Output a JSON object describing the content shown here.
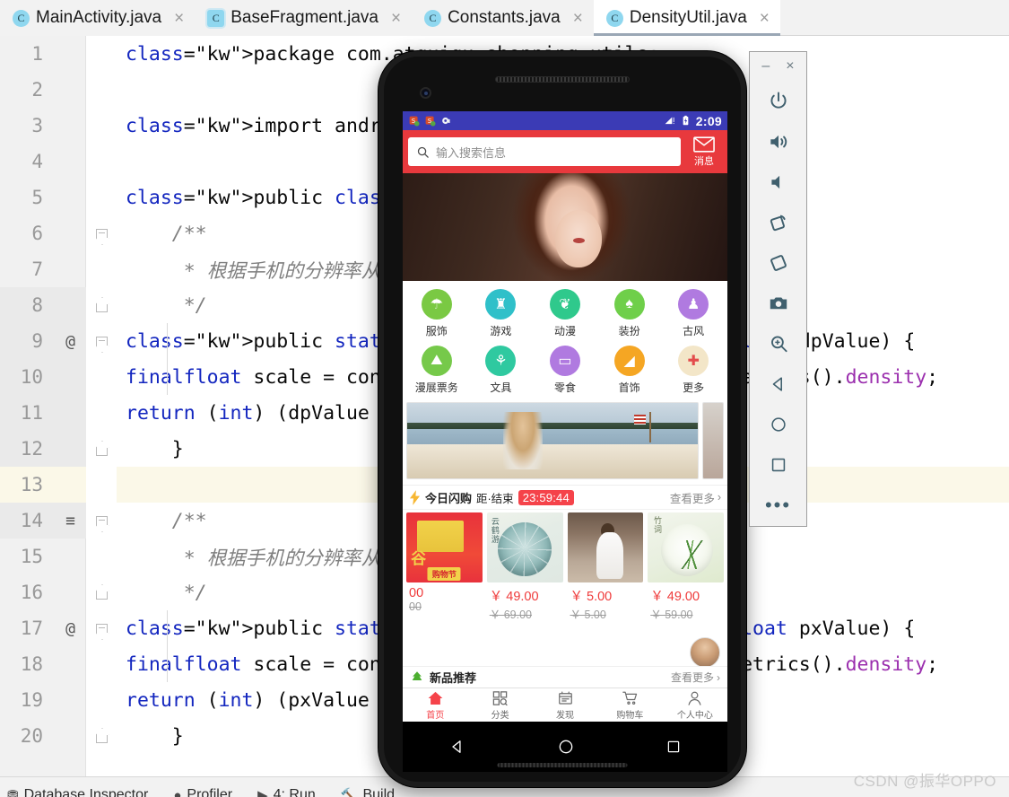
{
  "ide": {
    "tabs": [
      {
        "label": "MainActivity.java",
        "icon": "java-class-icon",
        "active": false,
        "boxed": false
      },
      {
        "label": "BaseFragment.java",
        "icon": "java-class-icon",
        "active": false,
        "boxed": true
      },
      {
        "label": "Constants.java",
        "icon": "java-class-icon",
        "active": false,
        "boxed": false
      },
      {
        "label": "DensityUtil.java",
        "icon": "java-class-icon",
        "active": true,
        "boxed": false
      }
    ],
    "tab_close_glyph": "×",
    "code_lines": [
      {
        "num": "1",
        "text": "package com.atguigu.shopping.utils;",
        "kind": "kw1",
        "fold": "",
        "mark": ""
      },
      {
        "num": "2",
        "text": "",
        "kind": "plain",
        "fold": "",
        "mark": ""
      },
      {
        "num": "3",
        "text": "import android.content.Context;",
        "kind": "kw1",
        "fold": "",
        "mark": ""
      },
      {
        "num": "4",
        "text": "",
        "kind": "plain",
        "fold": "",
        "mark": ""
      },
      {
        "num": "5",
        "text": "public class DensityUtil {",
        "kind": "kw2",
        "fold": "",
        "mark": ""
      },
      {
        "num": "6",
        "text": "    /**",
        "kind": "cm",
        "fold": "down",
        "mark": ""
      },
      {
        "num": "7",
        "text": "     * 根据手机的分辨率从 dp 的单位 转成为 px(像素)",
        "kind": "cm",
        "fold": "",
        "mark": ""
      },
      {
        "num": "8",
        "text": "     */",
        "kind": "cm",
        "fold": "up",
        "mark": ""
      },
      {
        "num": "9",
        "text": "    public static int dip2px(Context context, float dpValue) {",
        "kind": "kw3",
        "fold": "down",
        "mark": "@"
      },
      {
        "num": "10",
        "text": "        final float scale = context.getResources().getDisplayMetrics().density;",
        "kind": "kw4",
        "fold": "",
        "mark": ""
      },
      {
        "num": "11",
        "text": "        return (int) (dpValue * scale + 0.5f);",
        "kind": "kw5",
        "fold": "",
        "mark": ""
      },
      {
        "num": "12",
        "text": "    }",
        "kind": "plain",
        "fold": "up",
        "mark": ""
      },
      {
        "num": "13",
        "text": "",
        "kind": "plain",
        "fold": "",
        "mark": "",
        "highlight": true
      },
      {
        "num": "14",
        "text": "    /**",
        "kind": "cm",
        "fold": "down",
        "mark": "≡"
      },
      {
        "num": "15",
        "text": "     * 根据手机的分辨率从 px(像素) 的单位 转成为 dp",
        "kind": "cm",
        "fold": "",
        "mark": ""
      },
      {
        "num": "16",
        "text": "     */",
        "kind": "cm",
        "fold": "up",
        "mark": ""
      },
      {
        "num": "17",
        "text": "    public static int px2dip(Context context, float pxValue) {",
        "kind": "kw3",
        "fold": "down",
        "mark": "@"
      },
      {
        "num": "18",
        "text": "        final float scale = context.getResources().getDisplayMetrics().density;",
        "kind": "kw4",
        "fold": "",
        "mark": ""
      },
      {
        "num": "19",
        "text": "        return (int) (pxValue / scale + 0.5f);",
        "kind": "kw5",
        "fold": "",
        "mark": ""
      },
      {
        "num": "20",
        "text": "    }",
        "kind": "plain",
        "fold": "up",
        "mark": ""
      }
    ],
    "status_items": [
      "Database Inspector",
      "Profiler",
      "4: Run",
      "Build"
    ]
  },
  "emulator": {
    "window_minimize": "–",
    "window_close": "×",
    "buttons": [
      {
        "name": "power-icon"
      },
      {
        "name": "volume-up-icon"
      },
      {
        "name": "volume-down-icon"
      },
      {
        "name": "rotate-left-icon"
      },
      {
        "name": "rotate-right-icon"
      },
      {
        "name": "screenshot-camera-icon"
      },
      {
        "name": "zoom-icon"
      },
      {
        "name": "back-icon"
      },
      {
        "name": "home-icon"
      },
      {
        "name": "overview-icon"
      },
      {
        "name": "more-icon"
      }
    ],
    "more_glyph": "•••"
  },
  "phone": {
    "status": {
      "time": "2:09",
      "left_icons": [
        "notification-icon",
        "notification-icon",
        "sync-icon"
      ],
      "right_icons": [
        "signal-icon",
        "battery-icon"
      ]
    },
    "search": {
      "placeholder": "输入搜索信息",
      "value": "",
      "icon": "search-icon",
      "message_label": "消息",
      "message_icon": "envelope-icon",
      "accent": "#e8393d"
    },
    "categories": [
      {
        "label": "服饰",
        "color": "#7ac943",
        "glyph": "☂"
      },
      {
        "label": "游戏",
        "color": "#2fc0c9",
        "glyph": "♜"
      },
      {
        "label": "动漫",
        "color": "#2fc98c",
        "glyph": "❦"
      },
      {
        "label": "装扮",
        "color": "#6fcf4a",
        "glyph": "♠"
      },
      {
        "label": "古风",
        "color": "#b07ae0",
        "glyph": "♟"
      },
      {
        "label": "漫展票务",
        "color": "#76c94a",
        "glyph": "⛰"
      },
      {
        "label": "文具",
        "color": "#2fc9a0",
        "glyph": "⚘"
      },
      {
        "label": "零食",
        "color": "#b07ae0",
        "glyph": "▭"
      },
      {
        "label": "首饰",
        "color": "#f5a623",
        "glyph": "◢"
      },
      {
        "label": "更多",
        "color": "#f3e6c8",
        "glyph": "✚"
      }
    ],
    "flash": {
      "icon": "lightning-icon",
      "title": "今日闪购",
      "subtitle": "距·结束",
      "countdown": "23:59:44",
      "more": "查看更多",
      "chevron": "›",
      "badge_color": "#f5434a"
    },
    "sale_items": [
      {
        "thumb": "promo-banner",
        "price": "00",
        "old_price": "00",
        "promo_text": "谷",
        "promo_badge": "购物节"
      },
      {
        "thumb": "teal-umbrella",
        "price": "￥ 49.00",
        "old_price": "￥ 69.00",
        "cal": "云\n鹤\n游"
      },
      {
        "thumb": "white-dress",
        "price": "￥ 5.00",
        "old_price": "￥ 5.00",
        "cal": ""
      },
      {
        "thumb": "bamboo-umbrella",
        "price": "￥ 49.00",
        "old_price": "￥ 59.00",
        "cal": "竹\n词"
      }
    ],
    "new_section": {
      "icon": "leaf-icon",
      "label": "新品推荐",
      "more": "查看更多",
      "chevron": "›"
    },
    "tabs": [
      {
        "label": "首页",
        "icon": "home-icon",
        "active": true
      },
      {
        "label": "分类",
        "icon": "grid-search-icon",
        "active": false
      },
      {
        "label": "发现",
        "icon": "discover-icon",
        "active": false
      },
      {
        "label": "购物车",
        "icon": "cart-icon",
        "active": false
      },
      {
        "label": "个人中心",
        "icon": "person-icon",
        "active": false
      }
    ],
    "nav": [
      {
        "name": "back-triangle-icon"
      },
      {
        "name": "home-circle-icon"
      },
      {
        "name": "recents-square-icon"
      }
    ]
  },
  "watermark": "CSDN @振华OPPO"
}
